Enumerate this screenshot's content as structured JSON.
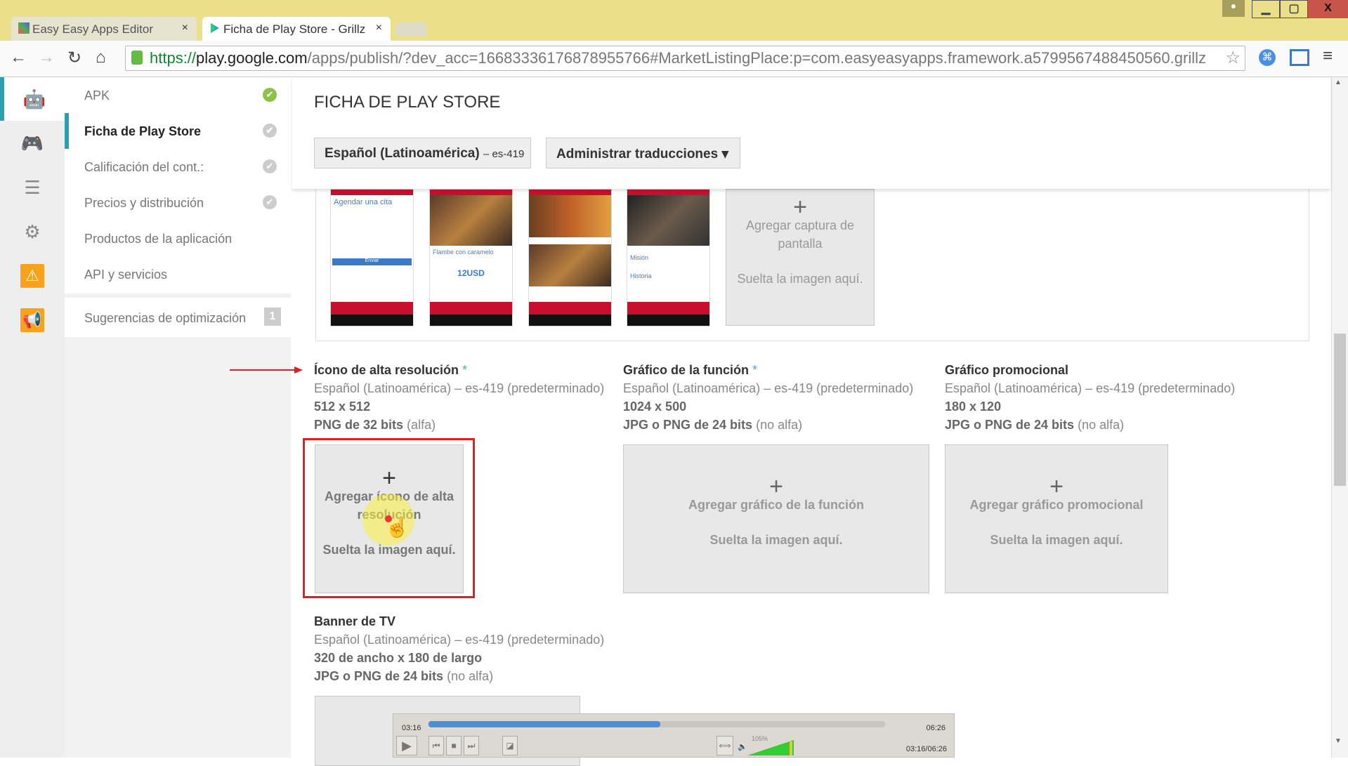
{
  "browser": {
    "tabs": [
      {
        "label": "Easy Easy Apps Editor",
        "close": "×"
      },
      {
        "label": "Ficha de Play Store - Grillz",
        "close": "×"
      }
    ],
    "url": {
      "scheme": "https://",
      "host": "play.google.com",
      "path": "/apps/publish/?dev_acc=16683336176878955766#MarketListingPlace:p=com.easyeasyapps.framework.a5799567488450560.grillz"
    },
    "window": {
      "minimize": "▁",
      "maximize": "▢",
      "close": "X"
    }
  },
  "sidebar": {
    "items": [
      {
        "label": "APK",
        "status": "complete"
      },
      {
        "label": "Ficha de Play Store",
        "status": "pending",
        "active": true
      },
      {
        "label": "Calificación del cont.:",
        "status": "pending"
      },
      {
        "label": "Precios y distribución",
        "status": "pending"
      },
      {
        "label": "Productos de la aplicación"
      },
      {
        "label": "API y servicios"
      }
    ],
    "suggestions": {
      "label": "Sugerencias de optimización",
      "count": "1"
    }
  },
  "rail": [
    "android-icon",
    "gamepad-icon",
    "database-icon",
    "gear-icon",
    "warning-icon",
    "megaphone-icon"
  ],
  "header": {
    "title": "FICHA DE PLAY STORE",
    "language_button": "Español (Latinoamérica)",
    "language_code": "– es-419",
    "translations_button": "Administrar traducciones ▾"
  },
  "screenshots": {
    "thumbs": [
      {
        "title": "Agendar una cita",
        "button": "Enviar"
      },
      {
        "title": "Flambe con caramelo",
        "price": "12USD"
      },
      {
        "title": ""
      },
      {
        "title": "Misión",
        "subtitle": "Historia"
      }
    ],
    "add": {
      "label": "Agregar captura de pantalla",
      "drop": "Suelta la imagen aquí."
    }
  },
  "assets": [
    {
      "title": "Ícono de alta resolución",
      "required": "*",
      "lang": "Español (Latinoamérica) – es-419 (predeterminado)",
      "size": "512 x 512",
      "format_bold": "PNG de 32 bits",
      "format_note": "(alfa)",
      "add": "Agregar ícono de alta resolución",
      "drop": "Suelta la imagen aquí."
    },
    {
      "title": "Gráfico de la función",
      "required": "*",
      "lang": "Español (Latinoamérica) – es-419 (predeterminado)",
      "size": "1024 x 500",
      "format_bold": "JPG o PNG de 24 bits",
      "format_note": "(no alfa)",
      "add": "Agregar gráfico de la función",
      "drop": "Suelta la imagen aquí."
    },
    {
      "title": "Gráfico promocional",
      "required": "",
      "lang": "Español (Latinoamérica) – es-419 (predeterminado)",
      "size": "180 x 120",
      "format_bold": "JPG o PNG de 24 bits",
      "format_note": "(no alfa)",
      "add": "Agregar gráfico promocional",
      "drop": "Suelta la imagen aquí."
    },
    {
      "title": "Banner de TV",
      "required": "",
      "lang": "Español (Latinoamérica) – es-419 (predeterminado)",
      "size": "320 de ancho x 180 de largo",
      "format_bold": "JPG o PNG de 24 bits",
      "format_note": "(no alfa)"
    }
  ],
  "video_player": {
    "elapsed": "03:16",
    "total": "06:26",
    "progress_fraction": 0.508,
    "volume": "105%",
    "time_readout": "03:16/06:26"
  },
  "colors": {
    "accent": "#2aa0b0",
    "highlight": "#e02020",
    "warning": "#f7a21a",
    "complete": "#8bc34a"
  }
}
